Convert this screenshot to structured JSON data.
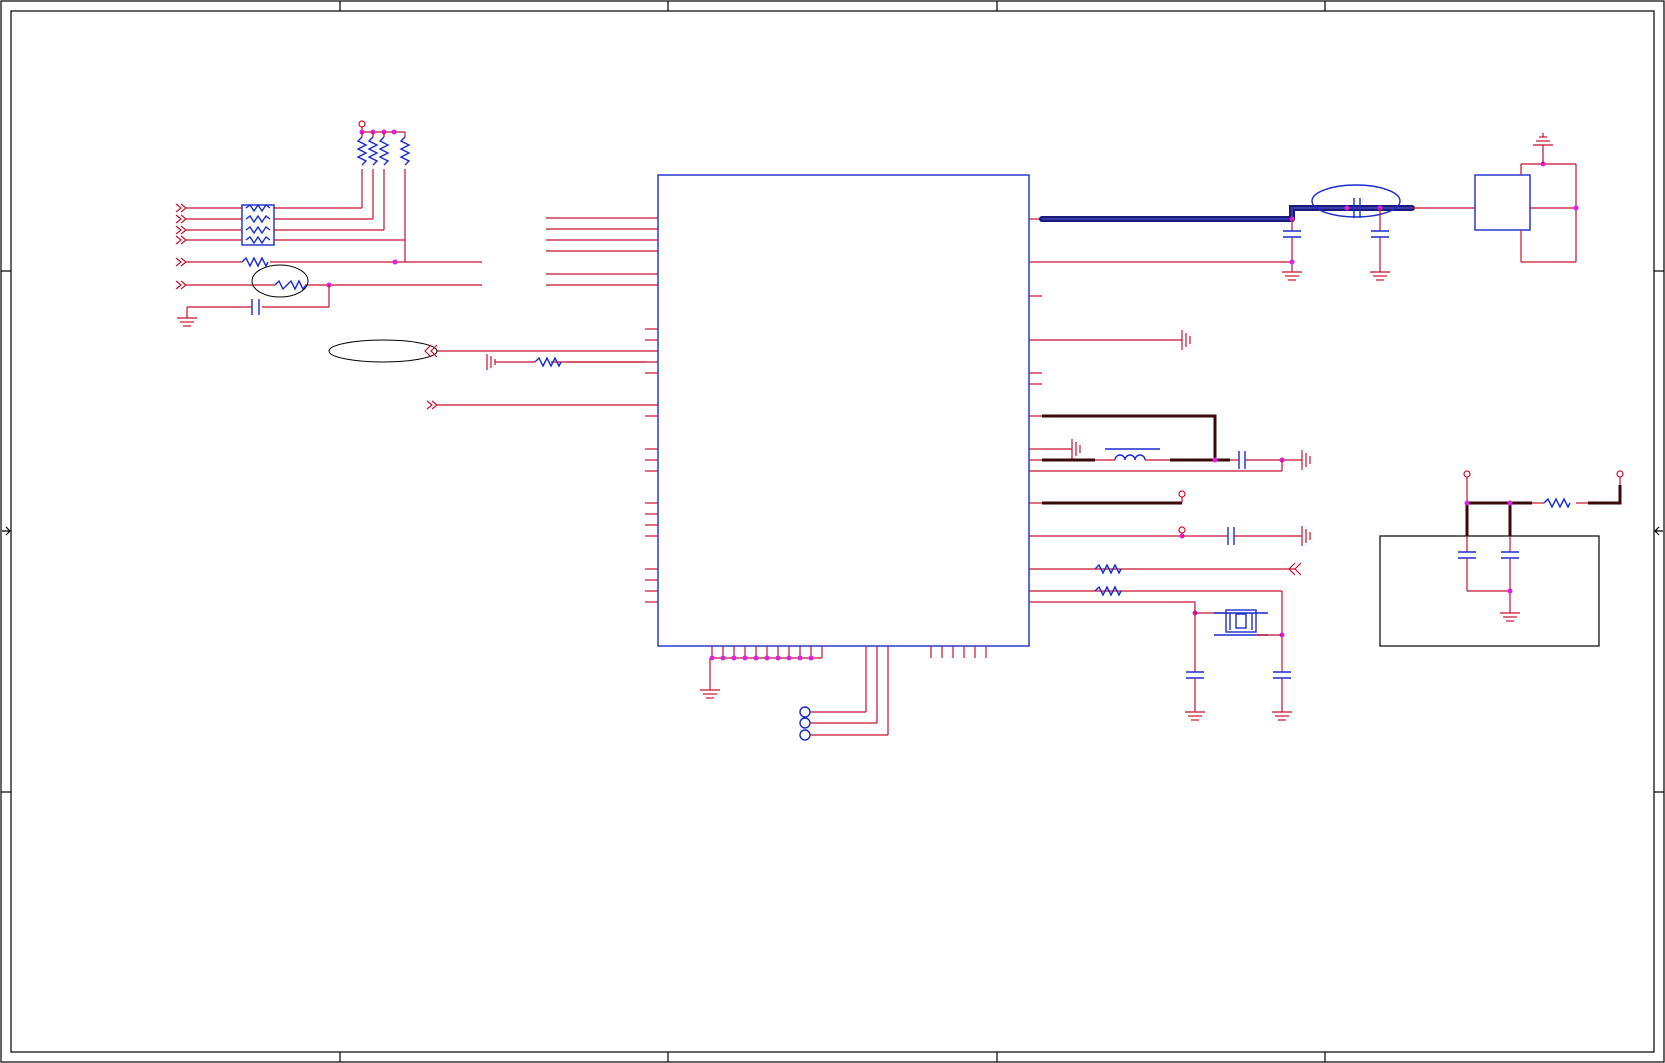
{
  "diagram": {
    "type": "electrical-schematic",
    "colors": {
      "wire": "#c8102e",
      "component": "#1a2bd0",
      "junction": "#e020e0",
      "frame": "#000000",
      "bus": "#1a1a7a",
      "power_net_heavy": "#3a0a0a"
    },
    "visible_text": []
  }
}
